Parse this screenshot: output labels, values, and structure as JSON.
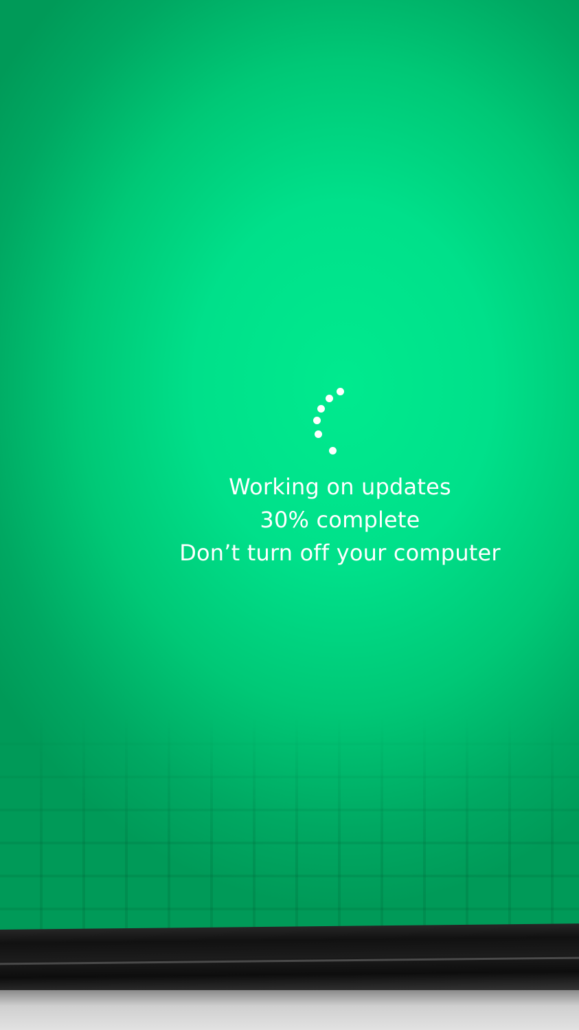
{
  "update_screen": {
    "title": "Working on updates",
    "progress_text": "30% complete",
    "progress_fraction": 0.3,
    "warning": "Don’t turn off your computer"
  },
  "colors": {
    "background_accent": "#00e08a",
    "text": "#ffffff"
  },
  "icons": {
    "spinner": "loading-spinner-icon"
  }
}
